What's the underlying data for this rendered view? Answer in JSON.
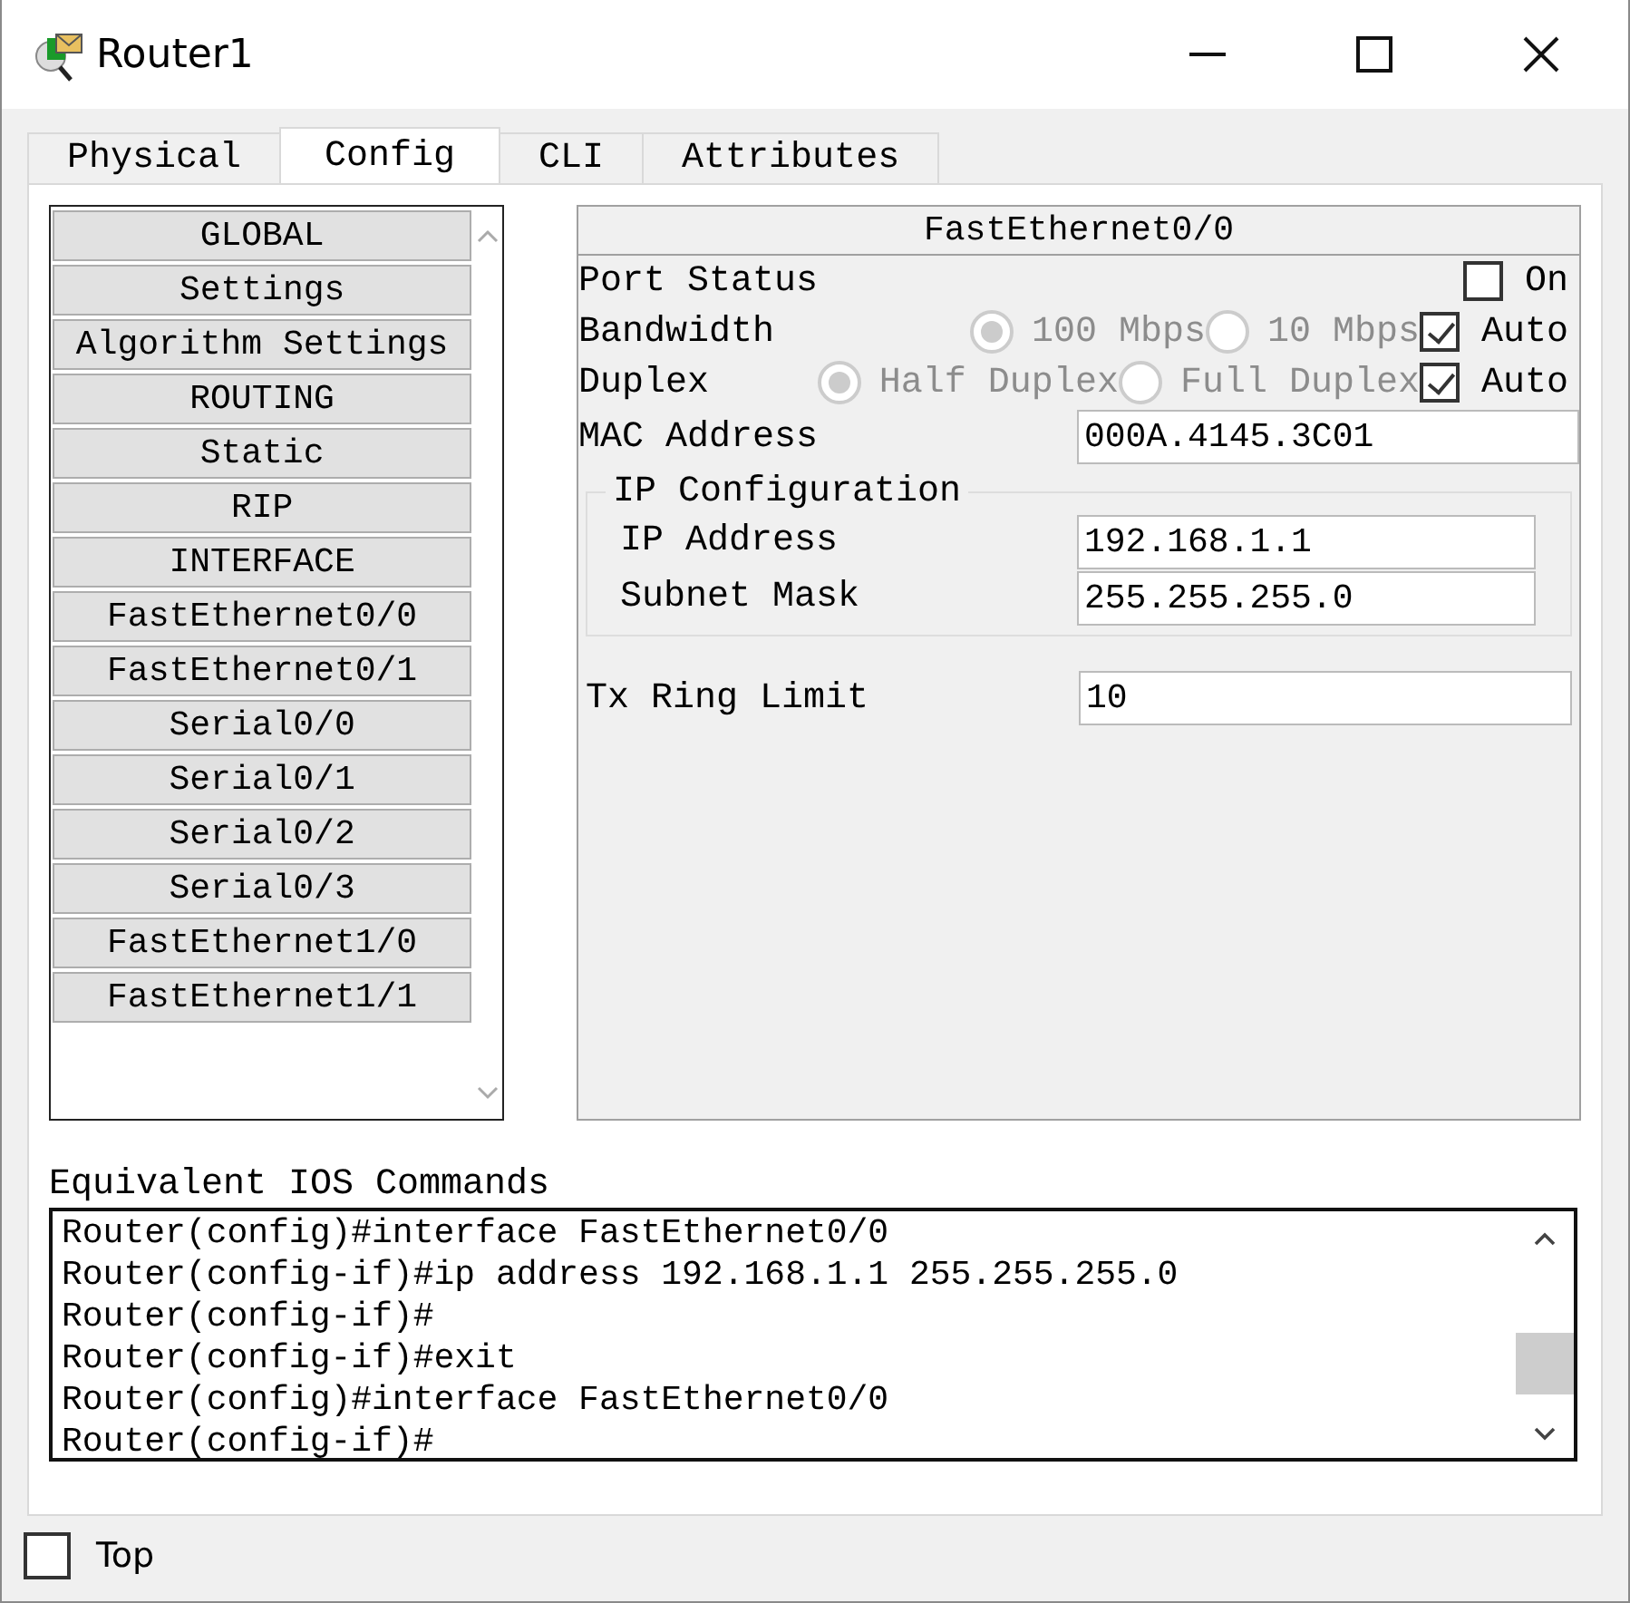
{
  "window": {
    "title": "Router1"
  },
  "tabs": [
    {
      "label": "Physical",
      "selected": false
    },
    {
      "label": "Config",
      "selected": true
    },
    {
      "label": "CLI",
      "selected": false
    },
    {
      "label": "Attributes",
      "selected": false
    }
  ],
  "sidebar": {
    "items": [
      {
        "label": "GLOBAL"
      },
      {
        "label": "Settings"
      },
      {
        "label": "Algorithm Settings"
      },
      {
        "label": "ROUTING"
      },
      {
        "label": "Static"
      },
      {
        "label": "RIP"
      },
      {
        "label": "INTERFACE"
      },
      {
        "label": "FastEthernet0/0"
      },
      {
        "label": "FastEthernet0/1"
      },
      {
        "label": "Serial0/0"
      },
      {
        "label": "Serial0/1"
      },
      {
        "label": "Serial0/2"
      },
      {
        "label": "Serial0/3"
      },
      {
        "label": "FastEthernet1/0"
      },
      {
        "label": "FastEthernet1/1"
      }
    ]
  },
  "interface": {
    "title": "FastEthernet0/0",
    "port_status": {
      "label": "Port Status",
      "toggle": {
        "label": "On",
        "checked": false
      }
    },
    "settings": [
      {
        "label": "Bandwidth",
        "options": [
          {
            "label": "100 Mbps",
            "selected": true,
            "disabled": true
          },
          {
            "label": "10 Mbps",
            "selected": false,
            "disabled": true
          }
        ],
        "auto": {
          "label": "Auto",
          "checked": true
        }
      },
      {
        "label": "Duplex",
        "options": [
          {
            "label": "Half Duplex",
            "selected": true,
            "disabled": true
          },
          {
            "label": "Full Duplex",
            "selected": false,
            "disabled": true
          }
        ],
        "auto": {
          "label": "Auto",
          "checked": true
        }
      }
    ],
    "mac": {
      "label": "MAC Address",
      "value": "000A.4145.3C01"
    },
    "ip_config": {
      "title": "IP Configuration",
      "fields": [
        {
          "label": "IP Address",
          "value": "192.168.1.1"
        },
        {
          "label": "Subnet Mask",
          "value": "255.255.255.0"
        }
      ]
    },
    "tx_ring": {
      "label": "Tx Ring Limit",
      "value": "10"
    }
  },
  "commands": {
    "label": "Equivalent IOS Commands",
    "lines": [
      "Router(config)#interface FastEthernet0/0",
      "Router(config-if)#ip address 192.168.1.1 255.255.255.0",
      "Router(config-if)#",
      "Router(config-if)#exit",
      "Router(config)#interface FastEthernet0/0",
      "Router(config-if)#"
    ]
  },
  "top": {
    "label": "Top",
    "checked": false
  }
}
